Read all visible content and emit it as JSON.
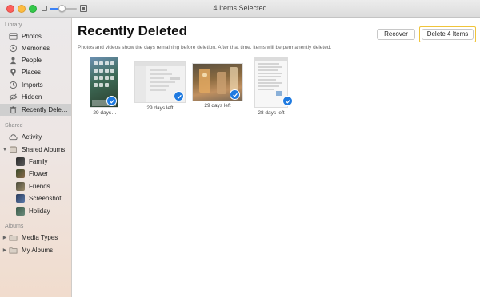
{
  "window": {
    "title": "4 Items Selected"
  },
  "toolbar": {
    "zoom_level": 0.45
  },
  "sidebar": {
    "library_label": "Library",
    "library_items": [
      {
        "label": "Photos",
        "icon": "photos-icon"
      },
      {
        "label": "Memories",
        "icon": "memories-icon"
      },
      {
        "label": "People",
        "icon": "people-icon"
      },
      {
        "label": "Places",
        "icon": "places-icon"
      },
      {
        "label": "Imports",
        "icon": "imports-icon"
      },
      {
        "label": "Hidden",
        "icon": "hidden-icon"
      },
      {
        "label": "Recently Dele…",
        "icon": "trash-icon",
        "selected": true
      }
    ],
    "shared_label": "Shared",
    "shared_items": [
      {
        "label": "Activity",
        "icon": "cloud-icon"
      },
      {
        "label": "Shared Albums",
        "icon": "shared-albums-icon"
      }
    ],
    "shared_albums": [
      {
        "label": "Family"
      },
      {
        "label": "Flower"
      },
      {
        "label": "Friends"
      },
      {
        "label": "Screenshot"
      },
      {
        "label": "Holiday"
      }
    ],
    "albums_label": "Albums",
    "album_items": [
      {
        "label": "Media Types",
        "icon": "folder-icon"
      },
      {
        "label": "My Albums",
        "icon": "folder-icon"
      }
    ]
  },
  "main": {
    "title": "Recently Deleted",
    "subtitle": "Photos and videos show the days remaining before deletion. After that time, items will be permanently deleted.",
    "recover_label": "Recover",
    "delete_label": "Delete 4 Items",
    "photos": [
      {
        "caption": "29 days…",
        "kind": "phone-screenshot",
        "selected": true
      },
      {
        "caption": "29 days left",
        "kind": "settings-screenshot",
        "selected": true
      },
      {
        "caption": "29 days left",
        "kind": "drinks-photo",
        "selected": true
      },
      {
        "caption": "28 days left",
        "kind": "document-screenshot",
        "selected": true
      }
    ]
  },
  "colors": {
    "accent": "#1f7ae0",
    "highlight_border": "#f0c43a",
    "sidebar_selected": "#cfcfcf"
  }
}
